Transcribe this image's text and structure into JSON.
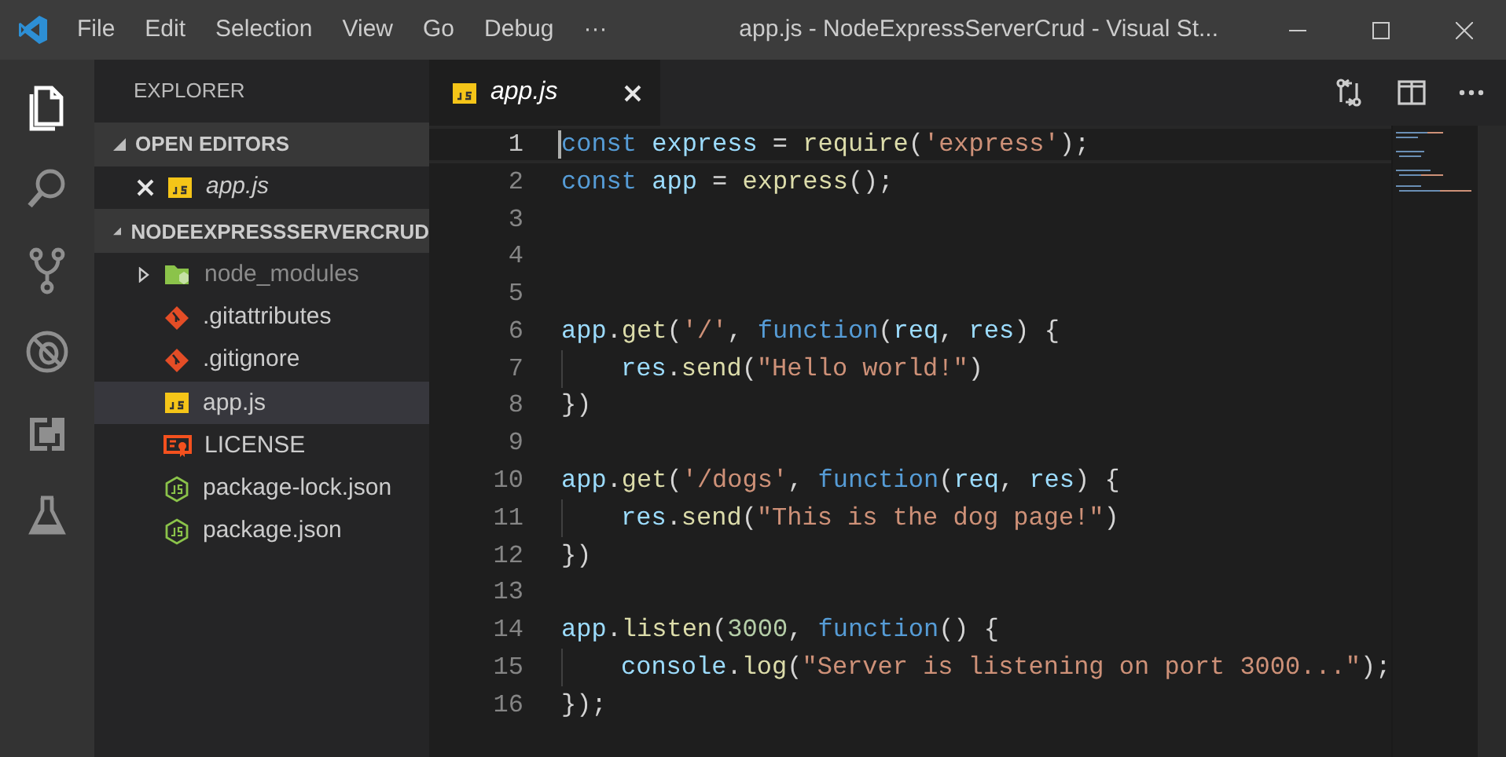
{
  "menu": [
    "File",
    "Edit",
    "Selection",
    "View",
    "Go",
    "Debug",
    "···"
  ],
  "window": {
    "title": "app.js - NodeExpressServerCrud - Visual St..."
  },
  "activity_bar": [
    {
      "kind": "files",
      "selected": true
    },
    {
      "kind": "search",
      "selected": false
    },
    {
      "kind": "source-control",
      "selected": false
    },
    {
      "kind": "debug",
      "selected": false
    },
    {
      "kind": "extensions",
      "selected": false
    },
    {
      "kind": "test",
      "selected": false
    }
  ],
  "sidebar": {
    "title": "EXPLORER",
    "sections": [
      {
        "label": "OPEN EDITORS",
        "expanded": true,
        "items": [
          {
            "label": "app.js",
            "kind": "js",
            "closable": true,
            "italic": true,
            "selected": false
          }
        ]
      },
      {
        "label": "NODEEXPRESSSERVERCRUD",
        "expanded": true,
        "items": [
          {
            "label": "node_modules",
            "kind": "folder",
            "expandable": true,
            "dimmed": true,
            "selected": false
          },
          {
            "label": ".gitattributes",
            "kind": "git",
            "selected": false
          },
          {
            "label": ".gitignore",
            "kind": "git",
            "selected": false
          },
          {
            "label": "app.js",
            "kind": "js",
            "selected": true
          },
          {
            "label": "LICENSE",
            "kind": "license",
            "selected": false
          },
          {
            "label": "package-lock.json",
            "kind": "node",
            "selected": false
          },
          {
            "label": "package.json",
            "kind": "node",
            "selected": false
          }
        ]
      }
    ]
  },
  "tabs": [
    {
      "label": "app.js",
      "selected": true
    }
  ],
  "editor": {
    "lines": [
      {
        "number": "1",
        "current": true,
        "tokens": [
          {
            "kind": "keyword",
            "text": "const "
          },
          {
            "kind": "variable",
            "text": "express"
          },
          {
            "kind": "plain",
            "text": " = "
          },
          {
            "kind": "function",
            "text": "require"
          },
          {
            "kind": "plain",
            "text": "("
          },
          {
            "kind": "string",
            "text": "'express'"
          },
          {
            "kind": "plain",
            "text": ");"
          }
        ]
      },
      {
        "number": "2",
        "tokens": [
          {
            "kind": "keyword",
            "text": "const "
          },
          {
            "kind": "variable",
            "text": "app"
          },
          {
            "kind": "plain",
            "text": " = "
          },
          {
            "kind": "function",
            "text": "express"
          },
          {
            "kind": "plain",
            "text": "();"
          }
        ]
      },
      {
        "number": "3"
      },
      {
        "number": "4"
      },
      {
        "number": "5"
      },
      {
        "number": "6",
        "tokens": [
          {
            "kind": "variable",
            "text": "app"
          },
          {
            "kind": "plain",
            "text": "."
          },
          {
            "kind": "function",
            "text": "get"
          },
          {
            "kind": "plain",
            "text": "("
          },
          {
            "kind": "string",
            "text": "'/'"
          },
          {
            "kind": "plain",
            "text": ", "
          },
          {
            "kind": "keyword",
            "text": "function"
          },
          {
            "kind": "plain",
            "text": "("
          },
          {
            "kind": "variable",
            "text": "req"
          },
          {
            "kind": "plain",
            "text": ", "
          },
          {
            "kind": "variable",
            "text": "res"
          },
          {
            "kind": "plain",
            "text": ") {"
          }
        ]
      },
      {
        "number": "7",
        "indent": true,
        "tokens": [
          {
            "kind": "variable",
            "text": "res"
          },
          {
            "kind": "plain",
            "text": "."
          },
          {
            "kind": "function",
            "text": "send"
          },
          {
            "kind": "plain",
            "text": "("
          },
          {
            "kind": "string",
            "text": "\"Hello world!\""
          },
          {
            "kind": "plain",
            "text": ")"
          }
        ]
      },
      {
        "number": "8",
        "tokens": [
          {
            "kind": "plain",
            "text": "})"
          }
        ]
      },
      {
        "number": "9"
      },
      {
        "number": "10",
        "tokens": [
          {
            "kind": "variable",
            "text": "app"
          },
          {
            "kind": "plain",
            "text": "."
          },
          {
            "kind": "function",
            "text": "get"
          },
          {
            "kind": "plain",
            "text": "("
          },
          {
            "kind": "string",
            "text": "'/dogs'"
          },
          {
            "kind": "plain",
            "text": ", "
          },
          {
            "kind": "keyword",
            "text": "function"
          },
          {
            "kind": "plain",
            "text": "("
          },
          {
            "kind": "variable",
            "text": "req"
          },
          {
            "kind": "plain",
            "text": ", "
          },
          {
            "kind": "variable",
            "text": "res"
          },
          {
            "kind": "plain",
            "text": ") {"
          }
        ]
      },
      {
        "number": "11",
        "indent": true,
        "tokens": [
          {
            "kind": "variable",
            "text": "res"
          },
          {
            "kind": "plain",
            "text": "."
          },
          {
            "kind": "function",
            "text": "send"
          },
          {
            "kind": "plain",
            "text": "("
          },
          {
            "kind": "string",
            "text": "\"This is the dog page!\""
          },
          {
            "kind": "plain",
            "text": ")"
          }
        ]
      },
      {
        "number": "12",
        "tokens": [
          {
            "kind": "plain",
            "text": "})"
          }
        ]
      },
      {
        "number": "13"
      },
      {
        "number": "14",
        "tokens": [
          {
            "kind": "variable",
            "text": "app"
          },
          {
            "kind": "plain",
            "text": "."
          },
          {
            "kind": "function",
            "text": "listen"
          },
          {
            "kind": "plain",
            "text": "("
          },
          {
            "kind": "number",
            "text": "3000"
          },
          {
            "kind": "plain",
            "text": ", "
          },
          {
            "kind": "keyword",
            "text": "function"
          },
          {
            "kind": "plain",
            "text": "() {"
          }
        ]
      },
      {
        "number": "15",
        "indent": true,
        "tokens": [
          {
            "kind": "variable",
            "text": "console"
          },
          {
            "kind": "plain",
            "text": "."
          },
          {
            "kind": "function",
            "text": "log"
          },
          {
            "kind": "plain",
            "text": "("
          },
          {
            "kind": "string",
            "text": "\"Server is listening on port 3000...\""
          },
          {
            "kind": "plain",
            "text": ");"
          }
        ]
      },
      {
        "number": "16",
        "tokens": [
          {
            "kind": "plain",
            "text": "});"
          }
        ]
      }
    ]
  }
}
